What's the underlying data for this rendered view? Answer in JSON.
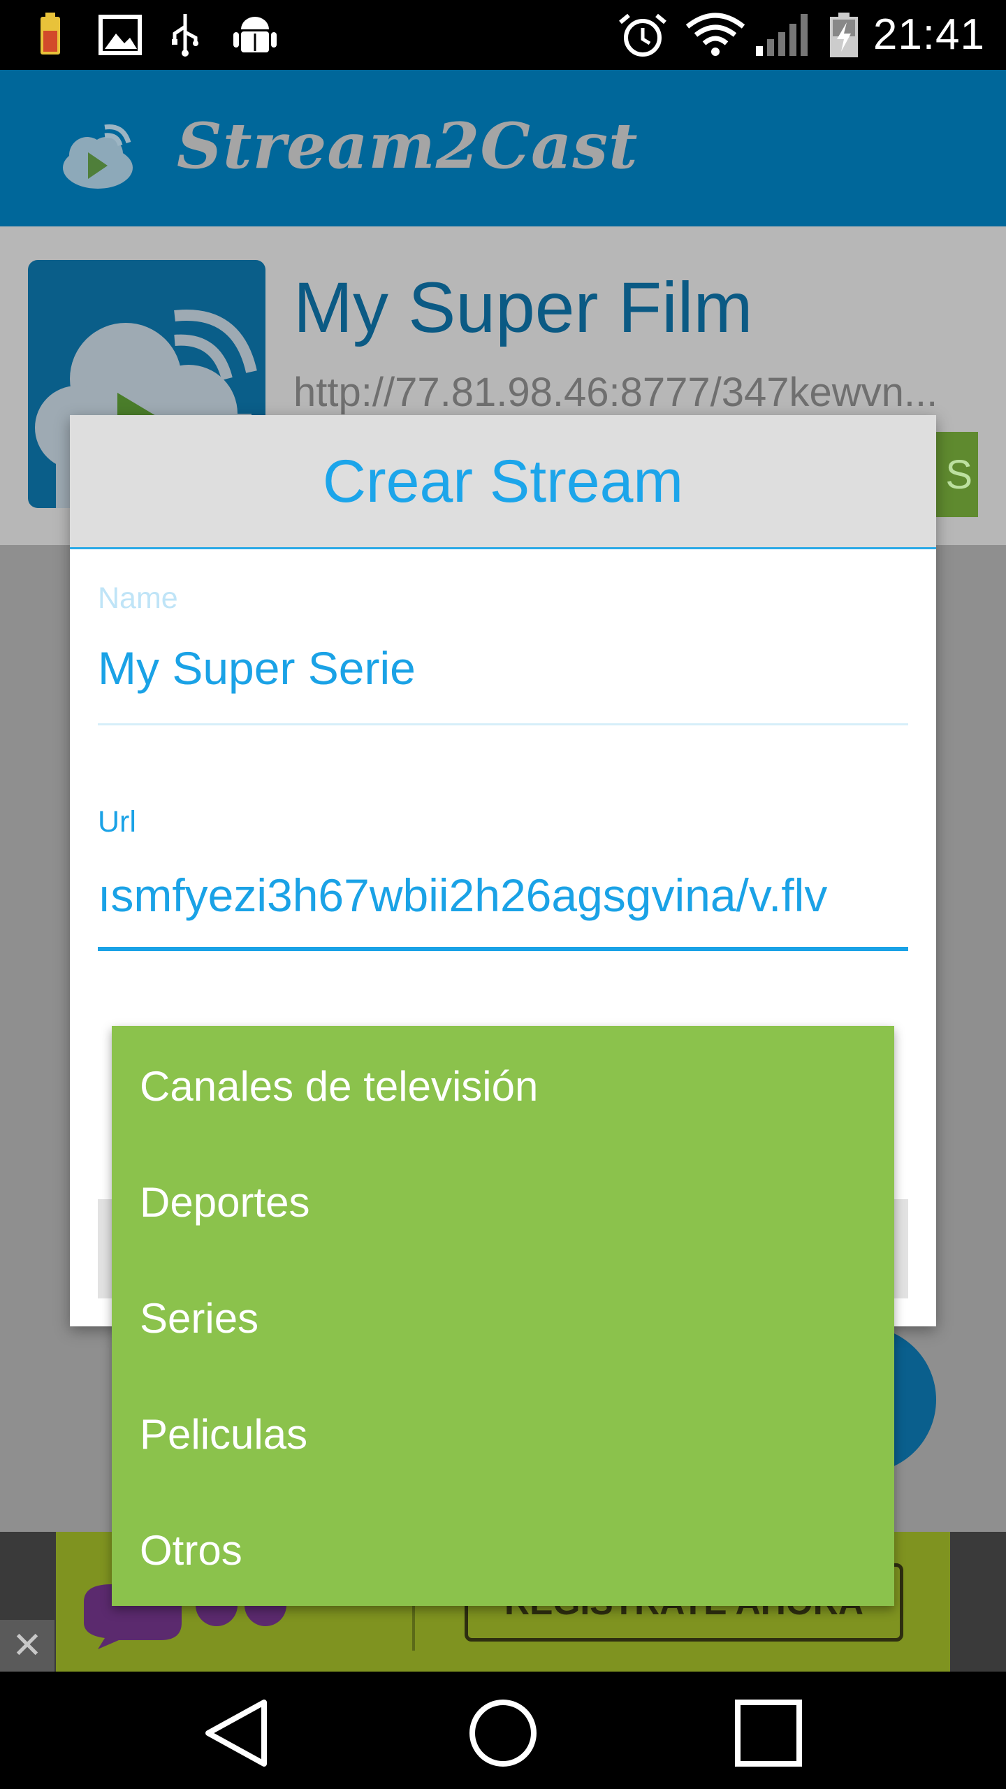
{
  "status_bar": {
    "time": "21:41",
    "icons_left": [
      "battery-saver-icon",
      "image-notification-icon",
      "usb-icon",
      "android-debug-icon"
    ],
    "icons_right": [
      "alarm-icon",
      "wifi-icon",
      "cell-signal-icon",
      "battery-charging-icon"
    ]
  },
  "app_bar": {
    "title": "Stream2Cast",
    "logo_icon": "cloud-play-cast-icon"
  },
  "stream_item": {
    "title": "My Super Film",
    "url": "http://77.81.98.46:8777/347kewvn...",
    "chip_text": "S"
  },
  "dialog": {
    "title": "Crear Stream",
    "name_label": "Name",
    "name_value": "My Super Serie",
    "url_label": "Url",
    "url_value": "ısmfyezi3h67wbii2h26agsgvina/v.flv"
  },
  "dropdown": {
    "options": [
      "Canales de televisión",
      "Deportes",
      "Series",
      "Peliculas",
      "Otros"
    ]
  },
  "ad": {
    "button_label": "REGISTRATE AHORA",
    "close_label": "✕"
  },
  "nav_bar": {
    "icons": [
      "back-icon",
      "home-icon",
      "recents-icon"
    ]
  },
  "colors": {
    "app_bar": "#00679a",
    "accent": "#1aa2e6",
    "dropdown": "#8bc24c",
    "dialog_header": "#dedede"
  }
}
